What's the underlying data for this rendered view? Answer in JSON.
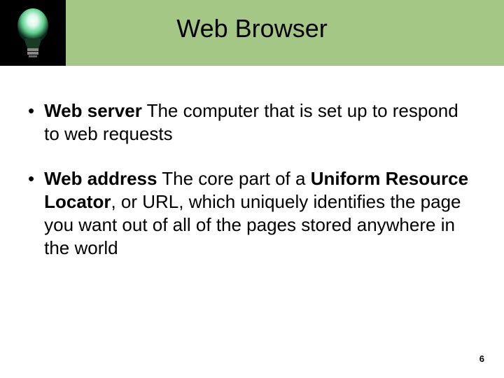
{
  "title": "Web Browser",
  "bullets": [
    {
      "term": "Web server",
      "sep": "  ",
      "definition": "The computer that is set up to respond to web requests"
    },
    {
      "term": "Web address",
      "sep": "   ",
      "definition_pre": "The core part of a ",
      "definition_bold": "Uniform Resource Locator",
      "definition_post": ", or URL, which uniquely identifies the page you want out of all of the pages stored anywhere in the world"
    }
  ],
  "page_number": "6"
}
